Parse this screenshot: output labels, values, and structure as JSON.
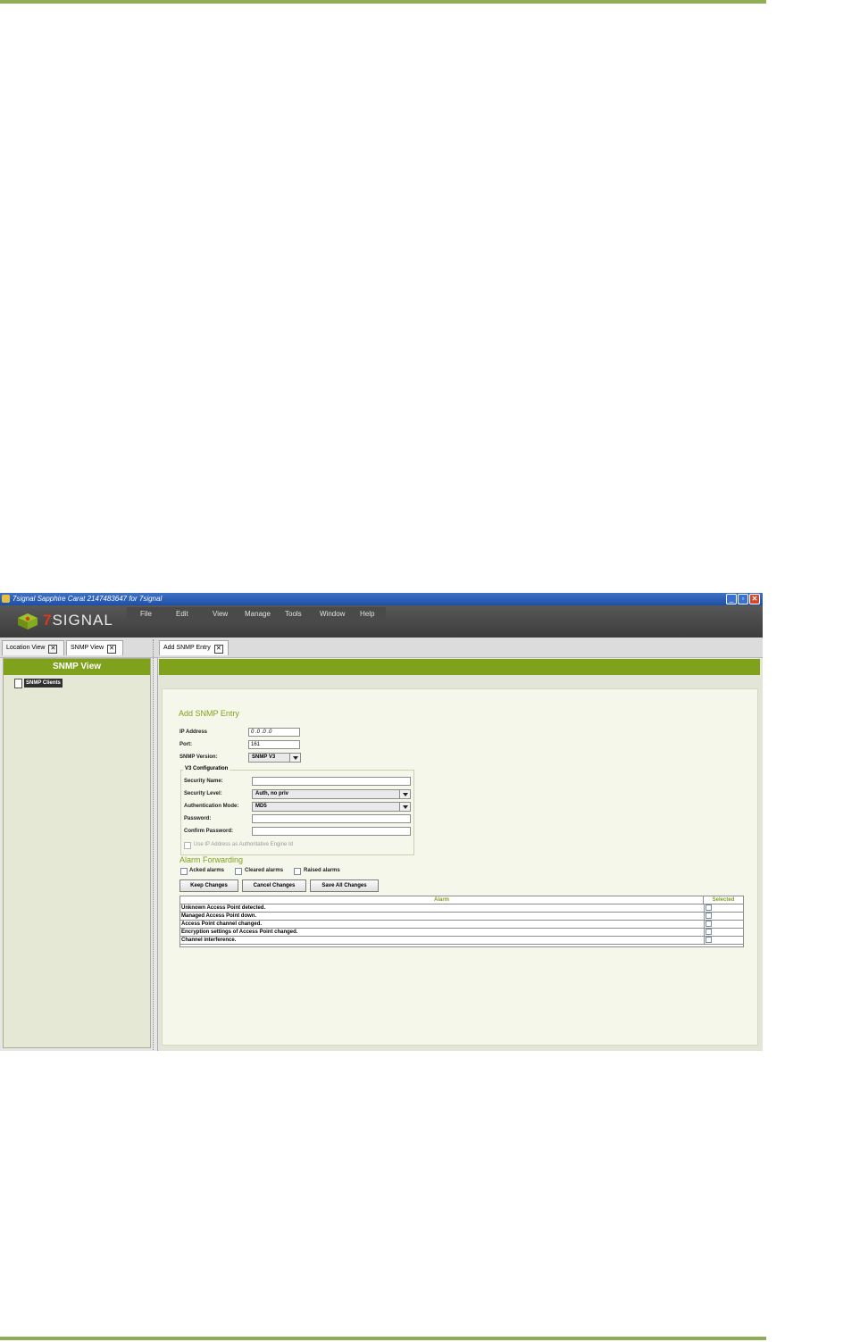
{
  "window": {
    "title": "7signal Sapphire Carat  2147483647 for 7signal",
    "minimize": "_",
    "maximize": "▫",
    "close": "✕"
  },
  "logo": {
    "seven": "7",
    "text": "SIGNAL"
  },
  "menu": [
    "File",
    "Edit",
    "View",
    "Manage",
    "Tools",
    "Window",
    "Help"
  ],
  "left_tabs": [
    {
      "label": "Location View"
    },
    {
      "label": "SNMP View"
    }
  ],
  "right_tabs": [
    {
      "label": "Add SNMP Entry"
    }
  ],
  "tab_close_glyph": "✕",
  "left_pane": {
    "header": "SNMP View",
    "tree": [
      {
        "label": "SNMP Clients",
        "icon": "document-icon"
      }
    ]
  },
  "form": {
    "title": "Add SNMP Entry",
    "ip_label": "IP Address",
    "ip_value": "0  .0  .0  .0",
    "port_label": "Port:",
    "port_value": "161",
    "version_label": "SNMP Version:",
    "version_value": "SNMP V3",
    "v3": {
      "legend": "V3 Configuration",
      "security_name_label": "Security Name:",
      "security_name_value": "",
      "security_level_label": "Security Level:",
      "security_level_value": "Auth, no priv",
      "auth_mode_label": "Authentication Mode:",
      "auth_mode_value": "MD5",
      "password_label": "Password:",
      "password_value": "",
      "confirm_label": "Confirm Password:",
      "confirm_value": "",
      "use_ip_label": "Use IP Address as Authoritative Engine Id",
      "use_ip_checked": false
    },
    "alarm_forwarding": {
      "title": "Alarm Forwarding",
      "options": [
        {
          "label": "Acked alarms",
          "checked": false
        },
        {
          "label": "Cleared alarms",
          "checked": false
        },
        {
          "label": "Raised alarms",
          "checked": false
        }
      ]
    },
    "buttons": {
      "keep": "Keep Changes",
      "cancel": "Cancel Changes",
      "save_all": "Save All Changes"
    },
    "table": {
      "headers": {
        "alarm": "Alarm",
        "selected": "Selected"
      },
      "rows": [
        {
          "alarm": "Unknown Access Point detected.",
          "selected": false
        },
        {
          "alarm": "Managed Access Point down.",
          "selected": false
        },
        {
          "alarm": "Access Point channel changed.",
          "selected": false
        },
        {
          "alarm": "Encryption settings of Access Point changed.",
          "selected": false
        },
        {
          "alarm": "Channel interference.",
          "selected": false
        }
      ]
    }
  },
  "colors": {
    "brand_green": "#7fa11b",
    "title_bar": "#1c4fa6",
    "header_dark": "#3c3c3c",
    "logo_red": "#d93a1e"
  }
}
